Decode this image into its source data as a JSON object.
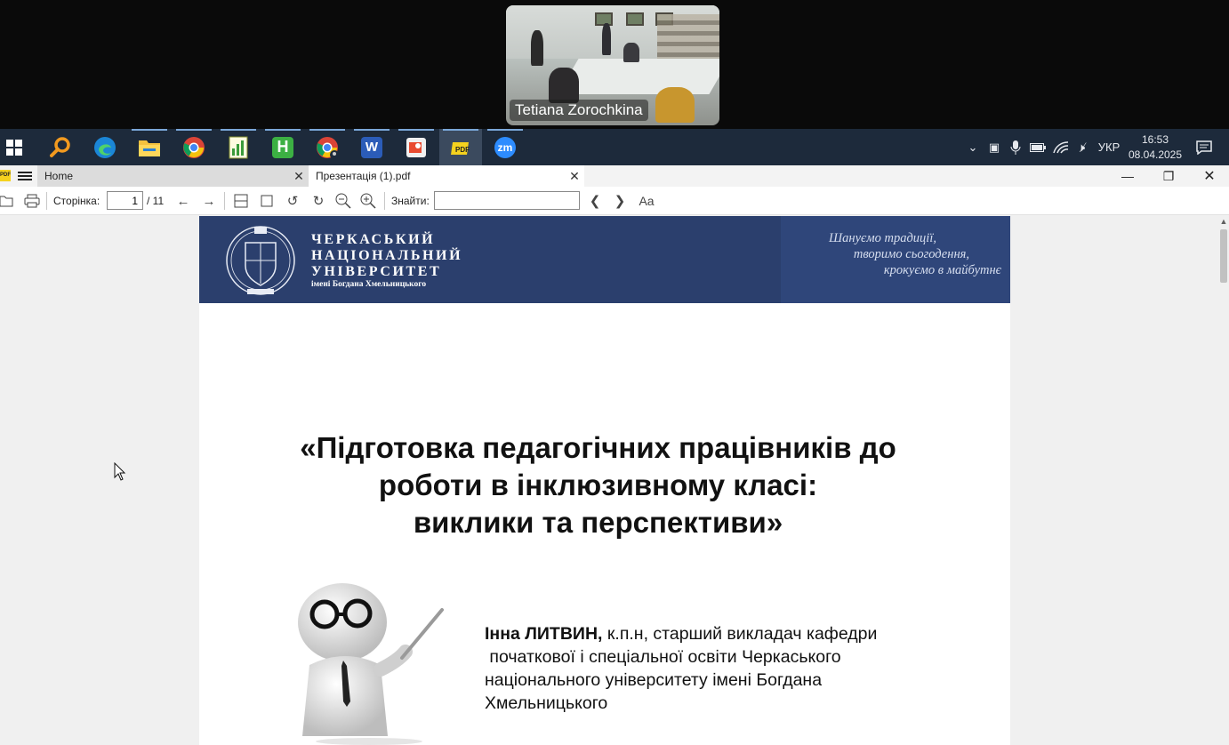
{
  "video": {
    "participant_name": "Tetiana Zorochkina"
  },
  "taskbar": {
    "apps": [
      {
        "name": "windows-start",
        "glyph": ""
      },
      {
        "name": "search",
        "glyph": ""
      },
      {
        "name": "edge",
        "glyph": ""
      },
      {
        "name": "file-explorer",
        "glyph": ""
      },
      {
        "name": "chrome",
        "glyph": ""
      },
      {
        "name": "app-chart",
        "glyph": ""
      },
      {
        "name": "app-h",
        "glyph": "H"
      },
      {
        "name": "chrome-2",
        "glyph": ""
      },
      {
        "name": "word",
        "glyph": "W"
      },
      {
        "name": "app-pdf",
        "glyph": ""
      },
      {
        "name": "pdf-viewer",
        "glyph": ""
      },
      {
        "name": "zoom",
        "glyph": "zm"
      }
    ],
    "language": "УКР",
    "time": "16:53",
    "date": "08.04.2025"
  },
  "viewer": {
    "tabs": [
      {
        "label": "Home"
      },
      {
        "label": "Презентація (1).pdf"
      }
    ],
    "toolbar": {
      "page_label": "Сторінка:",
      "page_value": "1",
      "page_total": "/ 11",
      "find_label": "Знайти:",
      "find_value": "",
      "font_button": "Aa"
    }
  },
  "slide": {
    "university_lines": [
      "ЧЕРКАСЬКИЙ",
      "НАЦІОНАЛЬНИЙ",
      "УНІВЕРСИТЕТ"
    ],
    "university_sub": "імені Богдана Хмельницького",
    "motto_lines": [
      "Шануємо традиції,",
      "творимо сьогодення,",
      "крокуємо в майбутнє"
    ],
    "title_lines": [
      "«Підготовка педагогічних працівників до",
      "роботи в інклюзивному класі:",
      "виклики та перспективи»"
    ],
    "author_name": "Інна ЛИТВИН,",
    "author_rest": " к.п.н, старший викладач кафедри",
    "author_lines": [
      " початкової і спеціальної освіти Черкаського",
      "національного університету імені Богдана",
      "Хмельницького"
    ]
  },
  "colors": {
    "taskbar": "#1d2a3b",
    "banner": "#2b3f6d",
    "page": "#ffffff",
    "viewer_bg": "#f0f0f0"
  }
}
